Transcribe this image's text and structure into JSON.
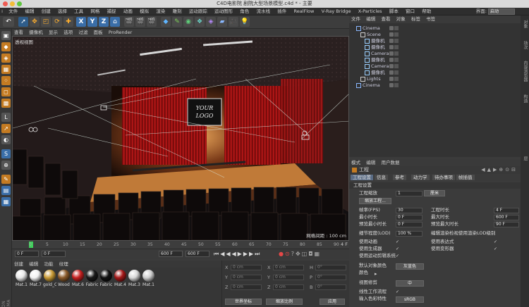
{
  "window": {
    "title": "C4D电影院 剧院大型场景模型.c4d * - 主要"
  },
  "menubar": {
    "items": [
      "文件",
      "编辑",
      "创建",
      "选择",
      "工具",
      "网格",
      "捕捉",
      "动画",
      "模拟",
      "渲染",
      "雕刻",
      "运动跟踪",
      "运动图形",
      "角色",
      "流水线",
      "插件",
      "RealFlow",
      "V-Ray Bridge",
      "X-Particles",
      "脚本",
      "窗口",
      "帮助"
    ],
    "layout_label": "界面:",
    "layout_value": "启动"
  },
  "viewport": {
    "menu": [
      "查看",
      "摄像机",
      "显示",
      "选项",
      "过滤",
      "面板",
      "ProRender"
    ],
    "label": "透视视图",
    "grid_spacing": "网格间距 : 100 cm",
    "screen_text": "YOUR LOGO"
  },
  "timeline": {
    "ticks": [
      "0",
      "5",
      "10",
      "15",
      "20",
      "25",
      "30",
      "35",
      "40",
      "45",
      "50",
      "55",
      "60",
      "65",
      "70",
      "75",
      "80",
      "85",
      "90"
    ],
    "current_frame": "0 F",
    "end_marker": "4 F",
    "start_field": "0 F",
    "start_field2": "0 F",
    "end_field": "600 F",
    "end_field2": "600 F"
  },
  "material_manager": {
    "menu": [
      "创建",
      "编辑",
      "功能",
      "纹理"
    ],
    "materials": [
      {
        "name": "Mat.1",
        "color": "#e8e8e8"
      },
      {
        "name": "Mat.7",
        "color": "#f2f2f2"
      },
      {
        "name": "gold_C",
        "color": "#c89a35"
      },
      {
        "name": "Wood",
        "color": "#8a5a2a"
      },
      {
        "name": "Mat.6",
        "color": "#c52020"
      },
      {
        "name": "Fabric",
        "color": "#1a1a1a"
      },
      {
        "name": "Fabric",
        "color": "#111111"
      },
      {
        "name": "Mat.4",
        "color": "#a51818"
      },
      {
        "name": "Mat.3",
        "color": "#d8d8d8"
      },
      {
        "name": "Mat.1",
        "color": "#cfcfcf"
      }
    ]
  },
  "coordinates": {
    "rows": [
      {
        "axis": "X",
        "pos": "0 cm",
        "axis2": "X",
        "size": "0 cm",
        "axis3": "H",
        "rot": "0°"
      },
      {
        "axis": "Y",
        "pos": "0 cm",
        "axis2": "Y",
        "size": "0 cm",
        "axis3": "P",
        "rot": "0°"
      },
      {
        "axis": "Z",
        "pos": "0 cm",
        "axis2": "Z",
        "size": "0 cm",
        "axis3": "B",
        "rot": "0°"
      }
    ],
    "mode_world": "世界坐标",
    "mode_scale": "缩放比例",
    "apply": "应用"
  },
  "object_manager": {
    "menu": [
      "文件",
      "编辑",
      "查看",
      "对象",
      "标签",
      "书签"
    ],
    "objects": [
      {
        "name": "Cinema",
        "indent": 0,
        "icon": "layer-icon"
      },
      {
        "name": "Scene",
        "indent": 1,
        "icon": "null-icon"
      },
      {
        "name": "摄像机",
        "indent": 2,
        "icon": "camera-icon"
      },
      {
        "name": "摄像机",
        "indent": 2,
        "icon": "camera-icon"
      },
      {
        "name": "Camera.1",
        "indent": 2,
        "icon": "camera-icon"
      },
      {
        "name": "摄像机",
        "indent": 2,
        "icon": "camera-icon"
      },
      {
        "name": "Camera.1",
        "indent": 2,
        "icon": "camera-icon"
      },
      {
        "name": "摄像机",
        "indent": 2,
        "icon": "camera-icon"
      },
      {
        "name": "Lights",
        "indent": 1,
        "icon": "null-icon"
      },
      {
        "name": "Cinema",
        "indent": 0,
        "icon": "layer-icon"
      }
    ],
    "right_tabs": [
      "对象",
      "场次",
      "内容浏览器",
      "构造",
      "层"
    ]
  },
  "attributes": {
    "menu": [
      "模式",
      "编辑",
      "用户数据"
    ],
    "title": "工程",
    "tabs": [
      "工程设置",
      "信息",
      "参考",
      "动力学",
      "待办事项",
      "帧插值"
    ],
    "section": "工程设置",
    "scale_label": "工程缩放",
    "scale_value": "1",
    "scale_unit": "厘米",
    "scale_button": "缩放工程...",
    "fps_label": "帧率(FPS)",
    "fps_value": "30",
    "project_time_label": "工程时长",
    "project_time_value": "4 F",
    "min_time_label": "最小时长",
    "min_time_value": "0 F",
    "max_time_label": "最大时长",
    "max_time_value": "600 F",
    "preview_min_label": "预览最小时长",
    "preview_min_value": "0 F",
    "preview_max_label": "预览最大时长",
    "preview_max_value": "90 F",
    "lod_label": "细节程度(LOD)",
    "lod_value": "100 %",
    "lod_render_label": "编辑渲染检视使用渲染LOD级别",
    "use_anim_label": "使用动画",
    "use_expr_label": "使用表达式",
    "use_gen_label": "使用生成器",
    "use_deform_label": "使用变形器",
    "use_motion_label": "使用运动剪辑系统",
    "default_color_label": "默认对象颜色",
    "default_color_value": "灰蓝色",
    "color_label": "颜色",
    "view_clip_label": "视图修剪",
    "view_clip_value": "中",
    "linear_label": "线性工作流程",
    "input_color_label": "输入色彩特性",
    "input_color_value": "sRGB"
  }
}
